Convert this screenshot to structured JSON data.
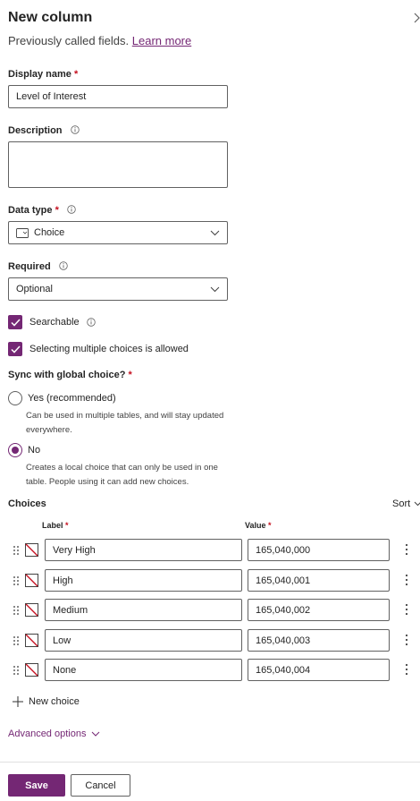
{
  "panel": {
    "title": "New column",
    "subtitle": "Previously called fields.",
    "learn_more": "Learn more"
  },
  "display_name": {
    "label": "Display name",
    "required_mark": "*",
    "value": "Level of Interest"
  },
  "description": {
    "label": "Description",
    "value": ""
  },
  "data_type": {
    "label": "Data type",
    "required_mark": "*",
    "value": "Choice",
    "icon": "choice-icon"
  },
  "required": {
    "label": "Required",
    "value": "Optional"
  },
  "searchable": {
    "label": "Searchable",
    "checked": true
  },
  "multiple": {
    "label": "Selecting multiple choices is allowed",
    "checked": true
  },
  "sync": {
    "label": "Sync with global choice?",
    "required_mark": "*",
    "yes_label": "Yes (recommended)",
    "yes_desc_1": "Can be used in multiple tables, and will stay updated",
    "yes_desc_2": "everywhere.",
    "no_label": "No",
    "no_desc_1": "Creates a local choice that can only be used in one",
    "no_desc_2": "table. People using it can add new choices.",
    "selected": "No"
  },
  "choices": {
    "title": "Choices",
    "sort_label": "Sort",
    "label_header": "Label",
    "value_header": "Value",
    "required_mark": "*",
    "items": [
      {
        "label": "Very High",
        "value": "165,040,000"
      },
      {
        "label": "High",
        "value": "165,040,001"
      },
      {
        "label": "Medium",
        "value": "165,040,002"
      },
      {
        "label": "Low",
        "value": "165,040,003"
      },
      {
        "label": "None",
        "value": "165,040,004"
      }
    ],
    "new_choice": "New choice"
  },
  "advanced_options": "Advanced options",
  "footer": {
    "save": "Save",
    "cancel": "Cancel"
  },
  "colors": {
    "accent": "#742774",
    "required": "#c50f1f",
    "border": "#616161"
  }
}
